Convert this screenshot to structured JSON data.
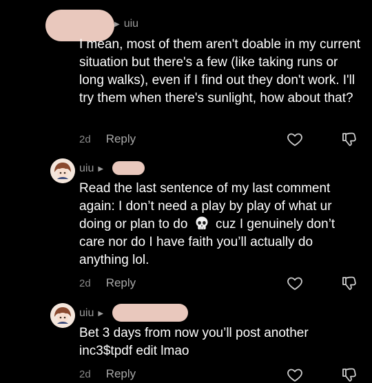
{
  "comments": [
    {
      "username": "uiu",
      "text": "I mean, most of them aren't doable in my current situation but there's a few (like taking runs or long walks), even if I find out they don't work. I'll try them when there's sunlight, how about that?",
      "age": "2d",
      "reply_label": "Reply"
    },
    {
      "username": "uiu",
      "text_before": "Read the last sentence of my last comment again: I don’t need a play by play of what ur doing or plan to do",
      "emoji": "skull",
      "text_after": "cuz I genuinely don’t care nor do I have faith you’ll actually do anything lol.",
      "age": "2d",
      "reply_label": "Reply"
    },
    {
      "username": "uiu",
      "text": "Bet 3 days from now you’ll post another inc3$tpdf edit lmao",
      "age": "2d",
      "reply_label": "Reply"
    }
  ],
  "icons": {
    "like": "heart-outline-icon",
    "dislike": "thumbs-down-outline-icon",
    "reply_arrow": "triangle-right-icon"
  },
  "colors": {
    "background": "#000000",
    "text": "#ffffff",
    "muted": "#9b9b9b",
    "redaction": "#e9c8bd"
  }
}
